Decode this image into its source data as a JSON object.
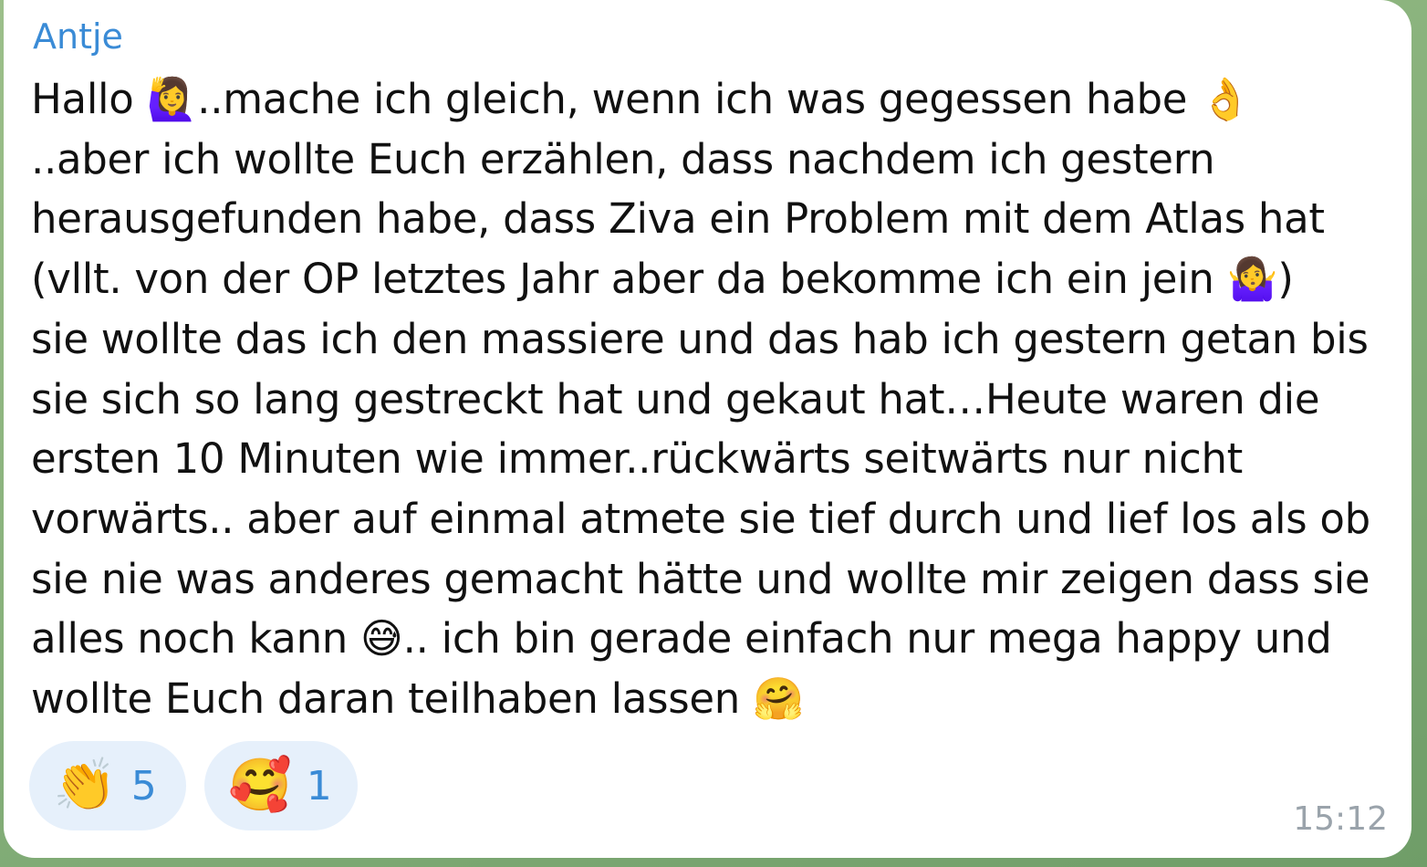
{
  "message": {
    "sender": "Antje",
    "text": "Hallo 🙋‍♀️..mache ich gleich, wenn ich was gegessen habe 👌\n..aber ich wollte Euch erzählen, dass nachdem ich gestern\nherausgefunden habe, dass Ziva ein Problem mit dem Atlas hat\n(vllt. von der OP letztes Jahr aber da bekomme ich ein jein 🤷‍♀️)\nsie wollte das ich den massiere und das hab ich gestern getan bis\nsie sich so lang gestreckt hat und gekaut hat…Heute waren die\nersten 10 Minuten wie immer..rückwärts seitwärts nur nicht\nvorwärts.. aber auf einmal atmete sie tief durch und lief los als ob\nsie nie was anderes gemacht hätte und wollte mir zeigen dass sie\nalles noch kann 😅.. ich bin gerade einfach nur mega happy und\nwollte Euch daran teilhaben lassen 🤗",
    "timestamp": "15:12"
  },
  "reactions": [
    {
      "emoji": "👏",
      "icon": "clapping-hands-icon",
      "count": "5"
    },
    {
      "emoji": "🥰",
      "icon": "smiling-face-with-hearts-icon",
      "count": "1"
    }
  ],
  "colors": {
    "sender": "#3a8bd6",
    "reaction_bg": "#e6f0fb",
    "bubble_bg": "#ffffff",
    "timestamp": "#9aa3ab"
  }
}
